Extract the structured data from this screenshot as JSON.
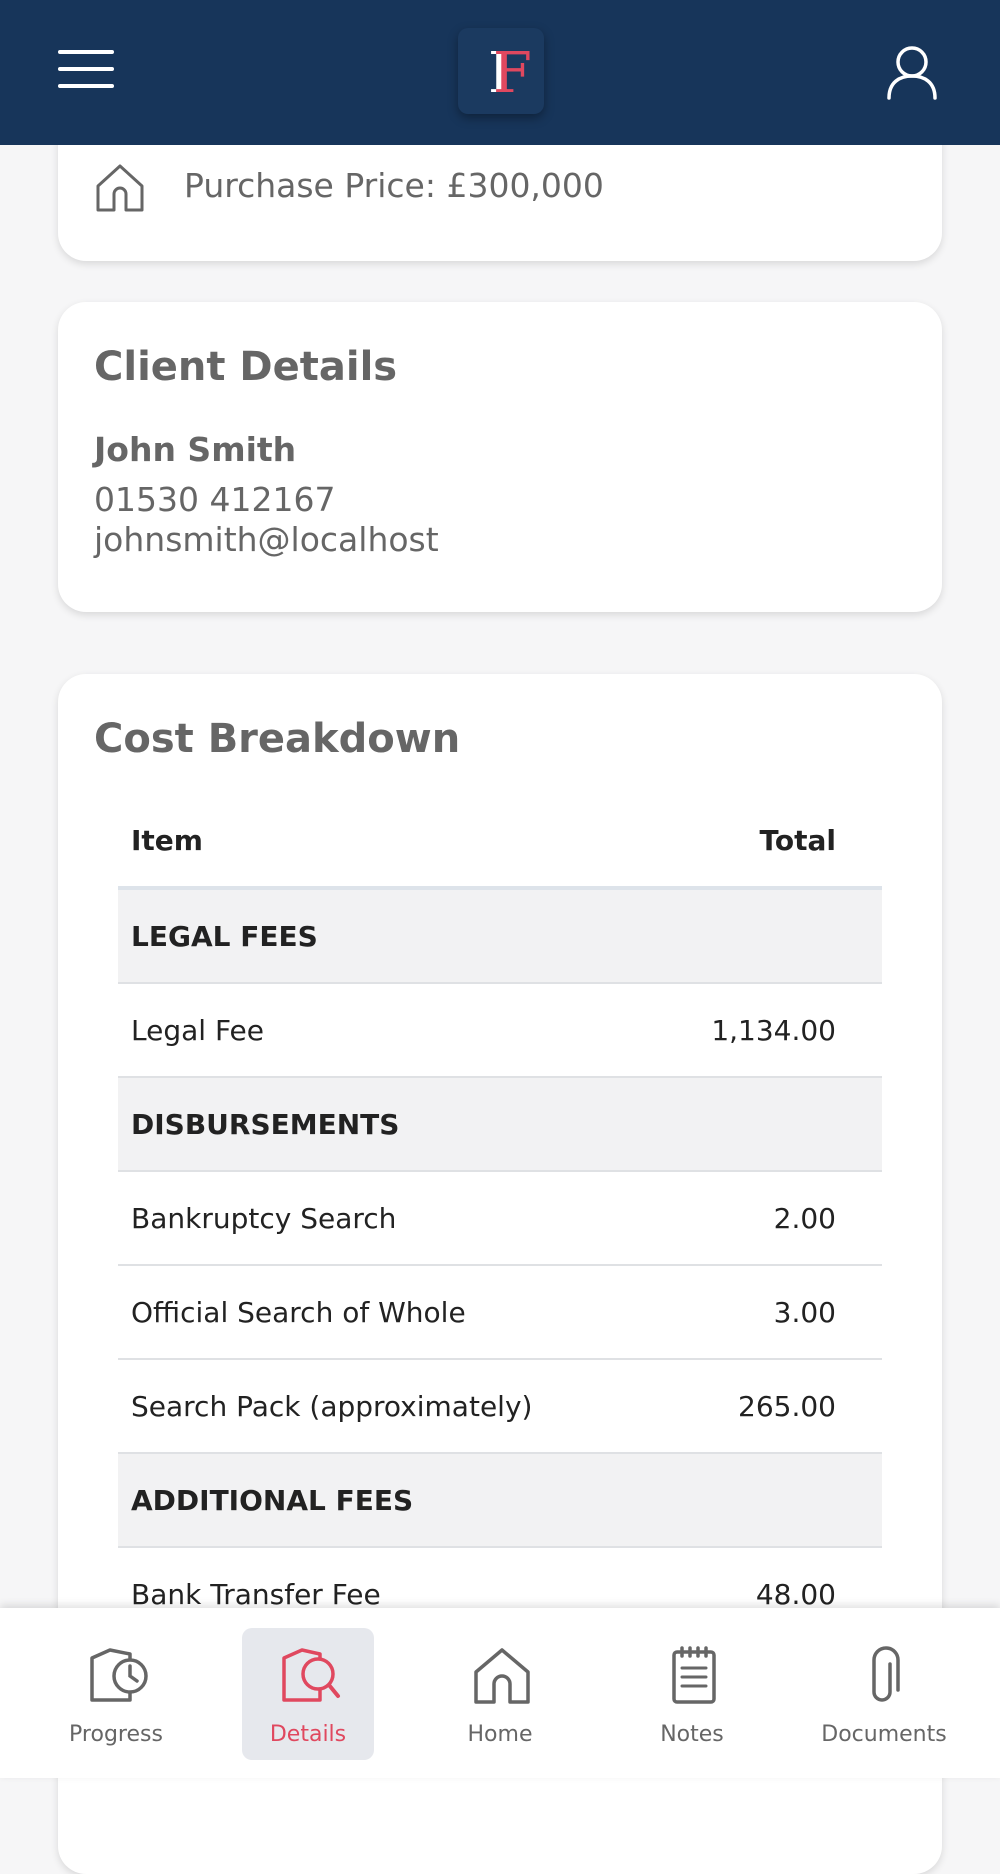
{
  "header": {
    "logo_letter": "F",
    "colors": {
      "background": "#17355a",
      "logo_accent": "#e0485f"
    }
  },
  "purchase": {
    "icon": "home-outline-icon",
    "price_label": "Purchase Price: £300,000"
  },
  "client": {
    "title": "Client Details",
    "name": "John Smith",
    "phone": "01530 412167",
    "email": "johnsmith@localhost"
  },
  "cost": {
    "title": "Cost Breakdown",
    "columns": {
      "item": "Item",
      "total": "Total"
    },
    "rows": [
      {
        "type": "section",
        "item": "LEGAL FEES",
        "total": ""
      },
      {
        "type": "line",
        "item": "Legal Fee",
        "total": "1,134.00"
      },
      {
        "type": "section",
        "item": "DISBURSEMENTS",
        "total": ""
      },
      {
        "type": "line",
        "item": "Bankruptcy Search",
        "total": "2.00"
      },
      {
        "type": "line",
        "item": "Official Search of Whole",
        "total": "3.00"
      },
      {
        "type": "line",
        "item": "Search Pack (approximately)",
        "total": "265.00"
      },
      {
        "type": "section",
        "item": "ADDITIONAL FEES",
        "total": ""
      },
      {
        "type": "line",
        "item": "Bank Transfer Fee",
        "total": "48.00"
      }
    ]
  },
  "nav": {
    "active": "Details",
    "active_color": "#e0485f",
    "items": [
      {
        "label": "Progress",
        "icon": "progress-clock-icon"
      },
      {
        "label": "Details",
        "icon": "details-search-icon"
      },
      {
        "label": "Home",
        "icon": "home-icon"
      },
      {
        "label": "Notes",
        "icon": "notes-icon"
      },
      {
        "label": "Documents",
        "icon": "paperclip-icon"
      }
    ]
  }
}
